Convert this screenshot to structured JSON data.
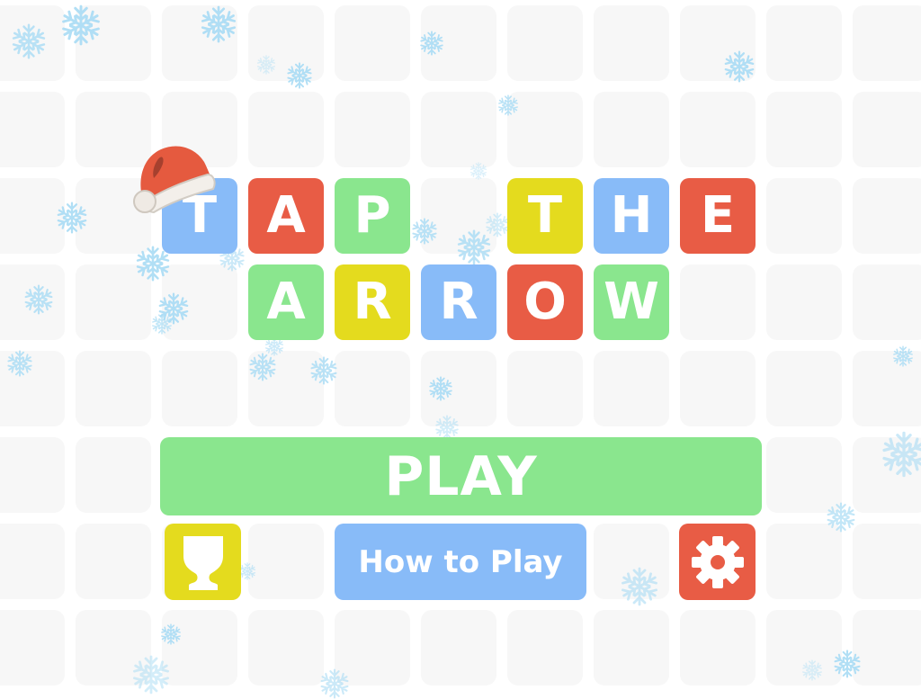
{
  "app": {
    "title": "Tap the Arrow"
  },
  "colors": {
    "background": "#ffffff",
    "grid_tile": "#f7f7f7",
    "blue": "#88bbf8",
    "red": "#e85c45",
    "green": "#8ae68e",
    "yellow": "#e4db1e",
    "snowflake": "#a9dcf5",
    "text": "#ffffff"
  },
  "logo": {
    "decoration": "santa-hat",
    "rows": [
      {
        "word": "TAP THE",
        "letters": [
          {
            "char": "T",
            "color": "blue"
          },
          {
            "char": "A",
            "color": "red"
          },
          {
            "char": "P",
            "color": "green"
          },
          {
            "char": "",
            "color": "none"
          },
          {
            "char": "T",
            "color": "yellow"
          },
          {
            "char": "H",
            "color": "blue"
          },
          {
            "char": "E",
            "color": "red"
          }
        ]
      },
      {
        "word": "ARROW",
        "letters": [
          {
            "char": "A",
            "color": "green"
          },
          {
            "char": "R",
            "color": "yellow"
          },
          {
            "char": "R",
            "color": "blue"
          },
          {
            "char": "O",
            "color": "red"
          },
          {
            "char": "W",
            "color": "green"
          }
        ]
      }
    ]
  },
  "menu": {
    "play_label": "PLAY",
    "howto_label": "How to Play",
    "leaderboard_icon": "trophy-cup-icon",
    "settings_icon": "gear-icon"
  }
}
